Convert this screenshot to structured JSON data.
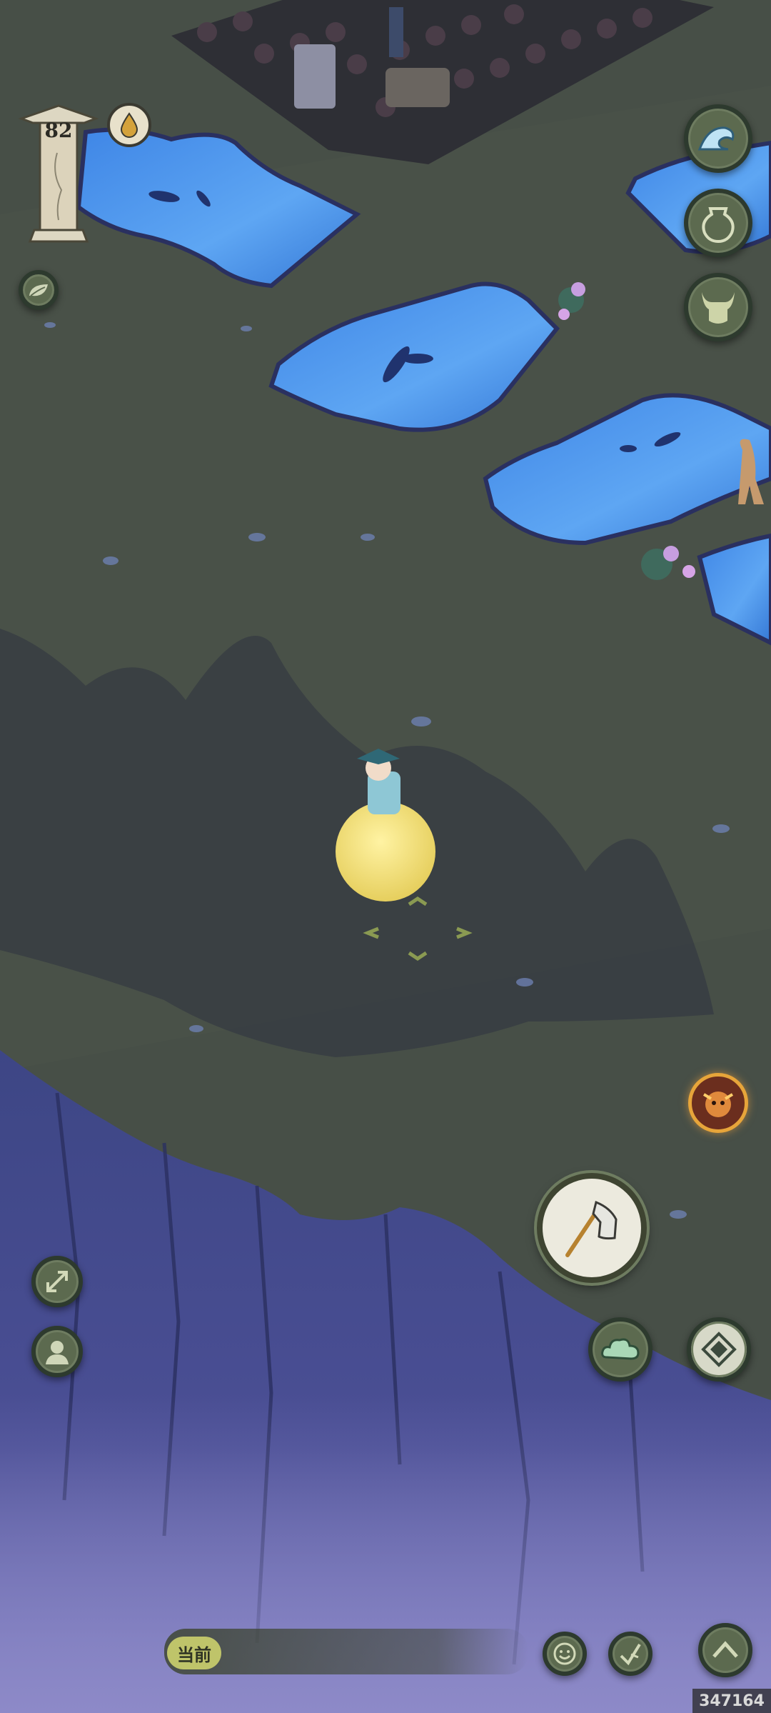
{
  "hud": {
    "player_level": "82",
    "chat_channel_tag": "当前",
    "build_id": "347164"
  },
  "controls": {
    "right_column": [
      "wave-skill-icon",
      "jar-item-icon",
      "ox-mount-icon"
    ],
    "leaf_button": "leaf-icon",
    "boss_alert": "flame-beast-icon",
    "main_action": "axe-icon",
    "cloud_skill": "cloud-icon",
    "diamond_skill": "diamond-compass-icon",
    "left_bottom": [
      "expand-arrows-icon",
      "character-profile-icon"
    ],
    "bottom_right": [
      "emote-smile-icon",
      "quick-action-icon",
      "expand-up-chevron-icon"
    ]
  },
  "colors": {
    "grass": "#4a5349",
    "water": "#4f98ee",
    "cliff": "#3e477f",
    "mist": "#7a79b8",
    "moon_orb": "#f3e27c",
    "button_fill": "#5c6a4f"
  }
}
